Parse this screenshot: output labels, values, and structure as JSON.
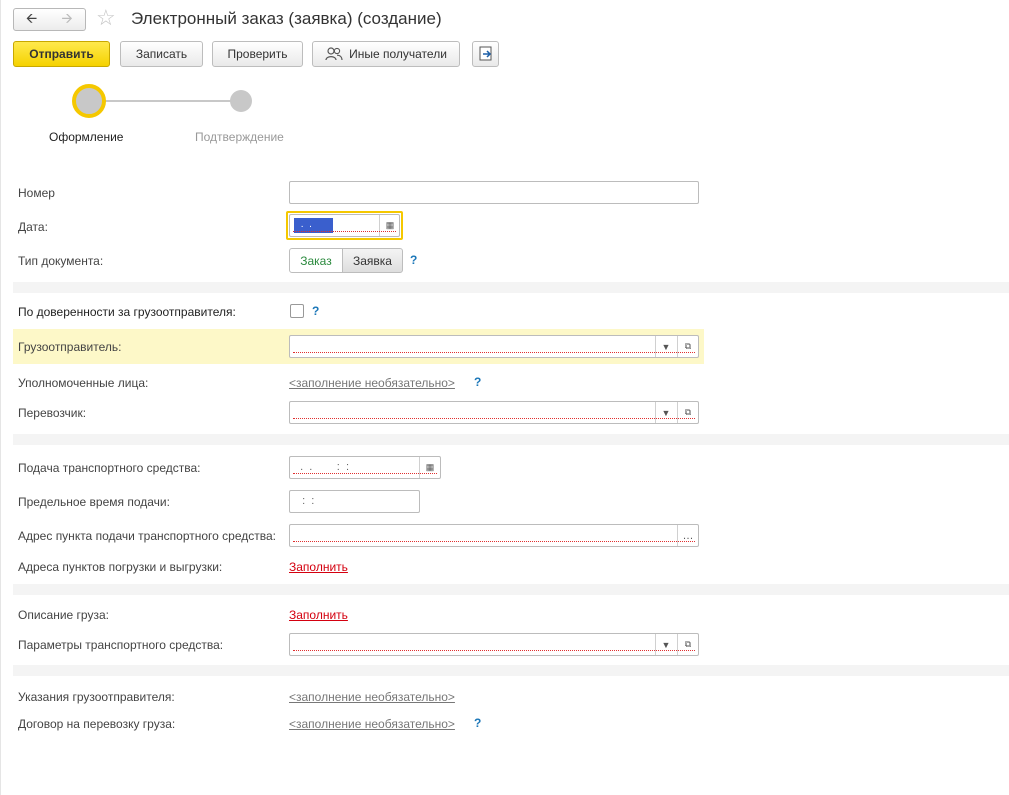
{
  "window": {
    "title": "Электронный заказ (заявка) (создание)",
    "back_icon": "arrow-left-icon",
    "forward_icon": "arrow-right-icon",
    "favorite_icon": "star-icon"
  },
  "toolbar": {
    "send_label": "Отправить",
    "save_label": "Записать",
    "check_label": "Проверить",
    "other_recipients_label": "Иные получатели",
    "extra_icon": "export-icon"
  },
  "stepper": {
    "step1": "Оформление",
    "step2": "Подтверждение",
    "active_step": 1
  },
  "form": {
    "number_label": "Номер",
    "number_value": "",
    "date_label": "Дата:",
    "date_mask": " .  .",
    "doc_type_label": "Тип документа:",
    "doc_type_options": [
      "Заказ",
      "Заявка"
    ],
    "doc_type_selected": "Заказ",
    "help_mark": "?",
    "power_of_attorney_label": "По доверенности за грузоотправителя:",
    "power_of_attorney_checked": false,
    "shipper_label": "Грузоотправитель:",
    "authorized_label": "Уполномоченные лица:",
    "optional_link": "<заполнение необязательно>",
    "carrier_label": "Перевозчик:",
    "vehicle_arrival_label": "Подача транспортного средства:",
    "vehicle_arrival_mask": "  .  .        :  :",
    "deadline_label": "Предельное время подачи:",
    "deadline_mask": "  :  :",
    "address_label": "Адрес пункта подачи транспортного средства:",
    "load_addresses_label": "Адреса пунктов погрузки и выгрузки:",
    "fill_link": "Заполнить",
    "cargo_desc_label": "Описание груза:",
    "vehicle_params_label": "Параметры транспортного средства:",
    "shipper_instructions_label": "Указания грузоотправителя:",
    "contract_label": "Договор на перевозку груза:"
  },
  "colors": {
    "primary_button": "#f5d200",
    "focus_border": "#f5c800",
    "required_underline": "#e03030",
    "link_red": "#d4000f",
    "help_blue": "#1c77b8",
    "highlight_row": "#fdf8c8"
  }
}
